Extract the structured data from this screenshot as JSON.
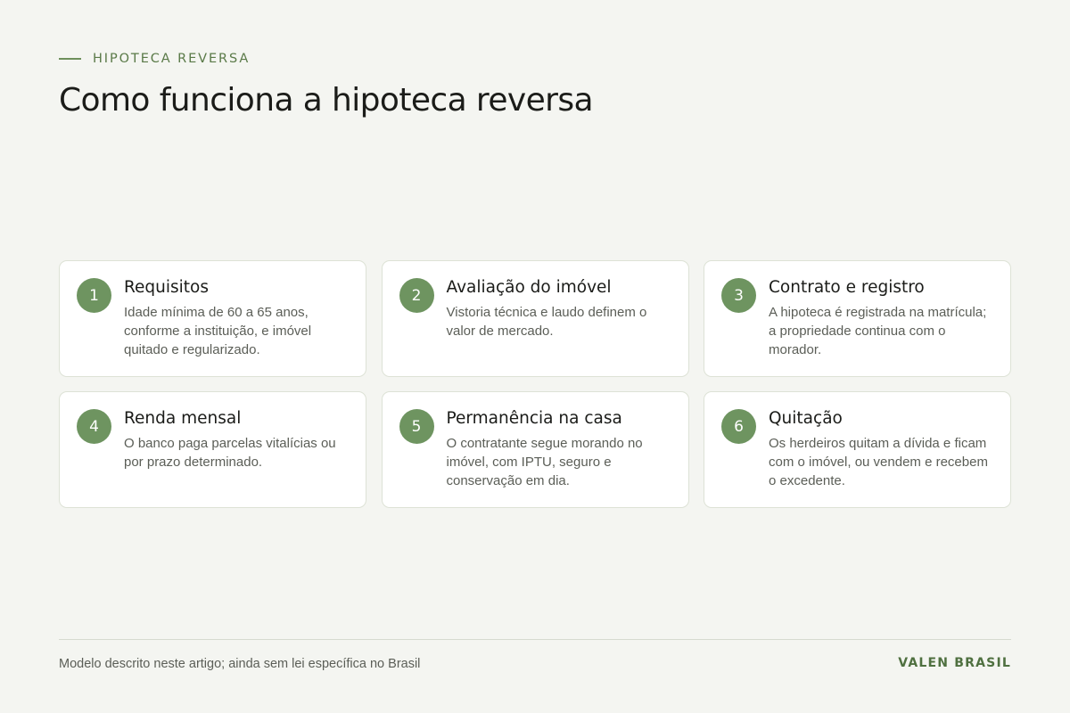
{
  "header": {
    "eyebrow": "HIPOTECA REVERSA",
    "title": "Como funciona a hipoteca reversa"
  },
  "steps": [
    {
      "number": "1",
      "title": "Requisitos",
      "description": "Idade mínima de 60 a 65 anos, conforme a instituição, e imóvel quitado e regularizado."
    },
    {
      "number": "2",
      "title": "Avaliação do imóvel",
      "description": "Vistoria técnica e laudo definem o valor de mercado."
    },
    {
      "number": "3",
      "title": "Contrato e registro",
      "description": "A hipoteca é registrada na matrícula; a propriedade continua com o morador."
    },
    {
      "number": "4",
      "title": "Renda mensal",
      "description": "O banco paga parcelas vitalícias ou por prazo determinado."
    },
    {
      "number": "5",
      "title": "Permanência na casa",
      "description": "O contratante segue morando no imóvel, com IPTU, seguro e conservação em dia."
    },
    {
      "number": "6",
      "title": "Quitação",
      "description": "Os herdeiros quitam a dívida e ficam com o imóvel, ou vendem e recebem o excedente."
    }
  ],
  "footer": {
    "note": "Modelo descrito neste artigo; ainda sem lei específica no Brasil",
    "brand": "VALEN BRASIL"
  },
  "colors": {
    "accent": "#6e9460",
    "brand": "#4f7040",
    "background": "#f4f5f1",
    "card": "#ffffff"
  }
}
